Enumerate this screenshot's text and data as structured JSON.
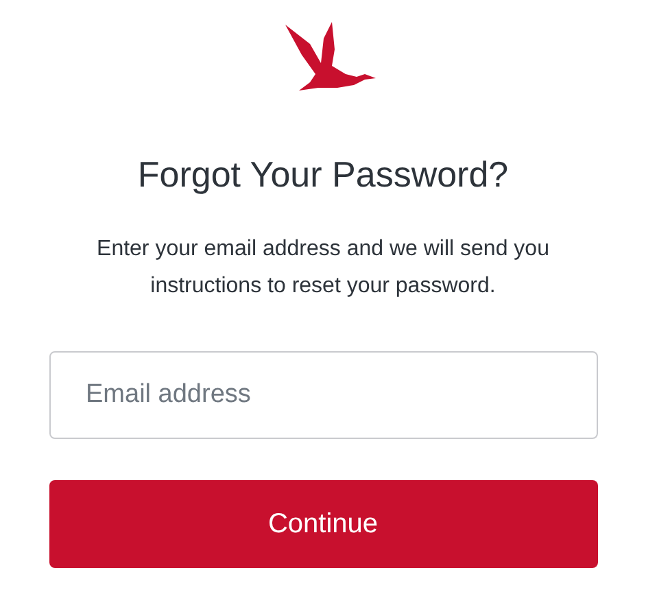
{
  "title": "Forgot Your Password?",
  "description": "Enter your email address and we will send you instructions to reset your password.",
  "email_field": {
    "placeholder": "Email address"
  },
  "buttons": [
    "Continue"
  ]
}
